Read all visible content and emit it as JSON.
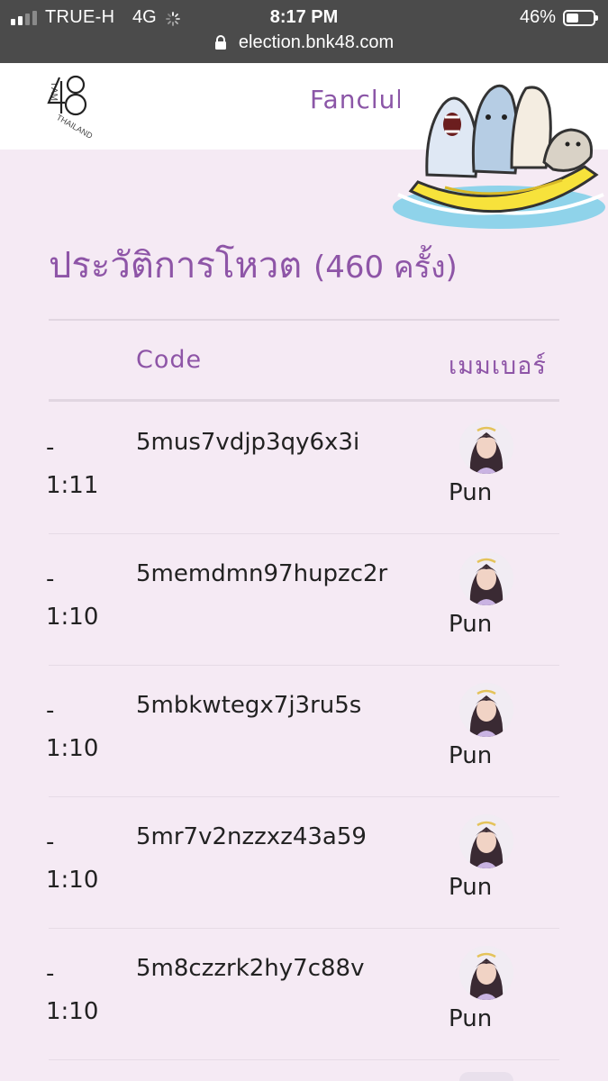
{
  "status_bar": {
    "carrier": "TRUE-H",
    "network": "4G",
    "time": "8:17 PM",
    "battery": "46%",
    "battery_level": 0.46,
    "url": "election.bnk48.com"
  },
  "header": {
    "logo_text": "I AM 48 THAILAND",
    "nav_item": "Fanclub"
  },
  "history": {
    "title": "ประวัติการโหวต",
    "count": "(460 ครั้ง)",
    "columns": {
      "time": "",
      "code": "Code",
      "member": "เมมเบอร์"
    },
    "rows": [
      {
        "dash": "-",
        "time": "1:11",
        "code": "5mus7vdjp3qy6x3i",
        "member": "Pun"
      },
      {
        "dash": "-",
        "time": "1:10",
        "code": "5memdmn97hupzc2r",
        "member": "Pun"
      },
      {
        "dash": "-",
        "time": "1:10",
        "code": "5mbkwtegx7j3ru5s",
        "member": "Pun"
      },
      {
        "dash": "-",
        "time": "1:10",
        "code": "5mr7v2nzzxz43a59",
        "member": "Pun"
      },
      {
        "dash": "-",
        "time": "1:10",
        "code": "5m8czzrk2hy7c88v",
        "member": "Pun"
      }
    ]
  },
  "colors": {
    "accent": "#8e55a7",
    "background": "#f5eaf4",
    "statusbar": "#4b4b4b"
  }
}
